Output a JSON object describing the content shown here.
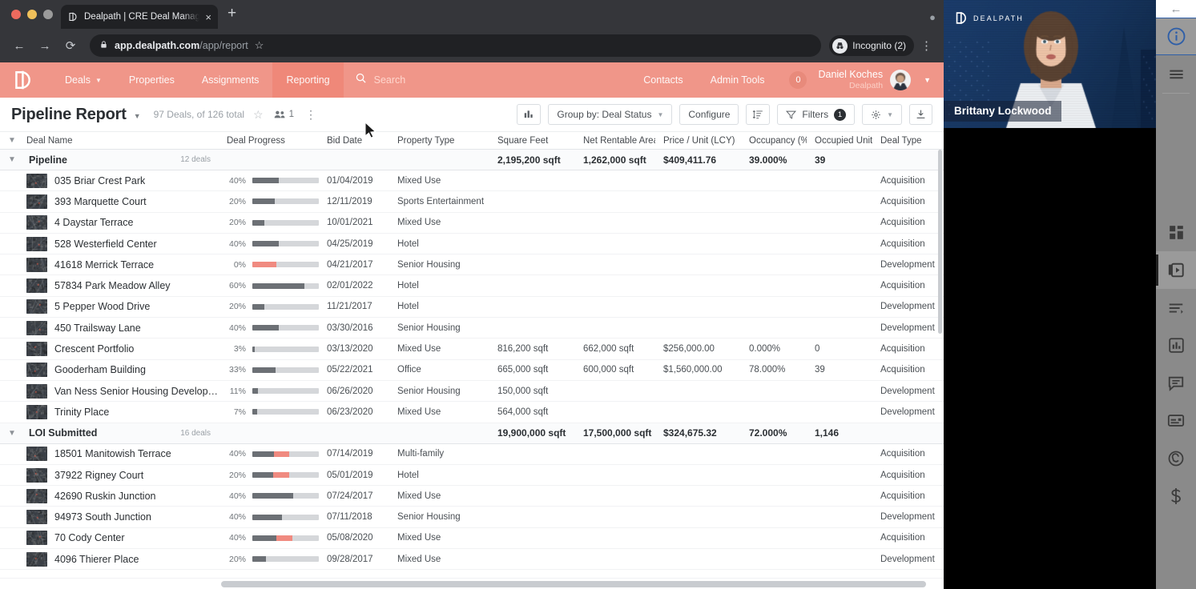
{
  "browser": {
    "tab": {
      "title": "Dealpath | CRE Deal Managem",
      "favicon": "dealpath-icon",
      "close": "×"
    },
    "new_tab": "+",
    "back": "←",
    "forward": "→",
    "reload": "⟳",
    "url_domain": "app.dealpath.com",
    "url_path": "/app/report",
    "lock": "🔒",
    "star": "☆",
    "profile_label": "Incognito (2)",
    "menu": "⋮"
  },
  "appnav": {
    "logo": "dealpath-logo",
    "items": [
      {
        "label": "Deals",
        "has_caret": true,
        "active": false
      },
      {
        "label": "Properties",
        "has_caret": false,
        "active": false
      },
      {
        "label": "Assignments",
        "has_caret": false,
        "active": false
      },
      {
        "label": "Reporting",
        "has_caret": false,
        "active": true
      }
    ],
    "search_placeholder": "Search",
    "right_items": [
      {
        "label": "Contacts"
      },
      {
        "label": "Admin Tools"
      }
    ],
    "notification_count": "0",
    "user_name": "Daniel Koches",
    "user_org": "Dealpath"
  },
  "report": {
    "title": "Pipeline Report",
    "count_text": "97 Deals, of 126 total",
    "share_count": "1",
    "toolbar": {
      "chart_button": "bar-chart-icon",
      "group_by": "Group by: Deal Status",
      "configure": "Configure",
      "sort_button": "sort-icon",
      "filters": "Filters",
      "filters_count": "1",
      "settings": "gear-icon",
      "download": "download-icon"
    }
  },
  "table": {
    "columns": [
      "Deal Name",
      "Deal Progress",
      "Bid Date",
      "Property Type",
      "Square Feet",
      "Net Rentable Area",
      "Price / Unit (LCY)",
      "Occupancy (%)",
      "Occupied Units",
      "Deal Type"
    ],
    "groups": [
      {
        "name": "Pipeline",
        "count": "12 deals",
        "summary": {
          "square_feet": "2,195,200 sqft",
          "net_rentable_area": "1,262,000 sqft",
          "price_per_unit": "$409,411.76",
          "occupancy": "39.000%",
          "occupied_units": "39"
        },
        "rows": [
          {
            "name": "035 Briar Crest Park",
            "pct": "40%",
            "fill": 40,
            "late": 0,
            "bid_date": "01/04/2019",
            "property_type": "Mixed Use",
            "square_feet": "",
            "nra": "",
            "price": "",
            "occupancy": "",
            "units": "",
            "deal_type": "Acquisition"
          },
          {
            "name": "393 Marquette Court",
            "pct": "20%",
            "fill": 34,
            "late": 0,
            "bid_date": "12/11/2019",
            "property_type": "Sports Entertainment",
            "square_feet": "",
            "nra": "",
            "price": "",
            "occupancy": "",
            "units": "",
            "deal_type": "Acquisition"
          },
          {
            "name": "4 Daystar Terrace",
            "pct": "20%",
            "fill": 18,
            "late": 0,
            "bid_date": "10/01/2021",
            "property_type": "Mixed Use",
            "square_feet": "",
            "nra": "",
            "price": "",
            "occupancy": "",
            "units": "",
            "deal_type": "Acquisition"
          },
          {
            "name": "528 Westerfield Center",
            "pct": "40%",
            "fill": 40,
            "late": 0,
            "bid_date": "04/25/2019",
            "property_type": "Hotel",
            "square_feet": "",
            "nra": "",
            "price": "",
            "occupancy": "",
            "units": "",
            "deal_type": "Acquisition"
          },
          {
            "name": "41618 Merrick Terrace",
            "pct": "0%",
            "fill": 36,
            "late": 36,
            "bid_date": "04/21/2017",
            "property_type": "Senior Housing",
            "square_feet": "",
            "nra": "",
            "price": "",
            "occupancy": "",
            "units": "",
            "deal_type": "Development"
          },
          {
            "name": "57834 Park Meadow Alley",
            "pct": "60%",
            "fill": 78,
            "late": 0,
            "bid_date": "02/01/2022",
            "property_type": "Hotel",
            "square_feet": "",
            "nra": "",
            "price": "",
            "occupancy": "",
            "units": "",
            "deal_type": "Acquisition"
          },
          {
            "name": "5 Pepper Wood Drive",
            "pct": "20%",
            "fill": 18,
            "late": 0,
            "bid_date": "11/21/2017",
            "property_type": "Hotel",
            "square_feet": "",
            "nra": "",
            "price": "",
            "occupancy": "",
            "units": "",
            "deal_type": "Development"
          },
          {
            "name": "450 Trailsway Lane",
            "pct": "40%",
            "fill": 40,
            "late": 0,
            "bid_date": "03/30/2016",
            "property_type": "Senior Housing",
            "square_feet": "",
            "nra": "",
            "price": "",
            "occupancy": "",
            "units": "",
            "deal_type": "Development"
          },
          {
            "name": "Crescent Portfolio",
            "pct": "3%",
            "fill": 4,
            "late": 0,
            "bid_date": "03/13/2020",
            "property_type": "Mixed Use",
            "square_feet": "816,200 sqft",
            "nra": "662,000 sqft",
            "price": "$256,000.00",
            "occupancy": "0.000%",
            "units": "0",
            "deal_type": "Acquisition"
          },
          {
            "name": "Gooderham Building",
            "pct": "33%",
            "fill": 35,
            "late": 0,
            "bid_date": "05/22/2021",
            "property_type": "Office",
            "square_feet": "665,000 sqft",
            "nra": "600,000 sqft",
            "price": "$1,560,000.00",
            "occupancy": "78.000%",
            "units": "39",
            "deal_type": "Acquisition"
          },
          {
            "name": "Van Ness Senior Housing Development",
            "pct": "11%",
            "fill": 9,
            "late": 0,
            "bid_date": "06/26/2020",
            "property_type": "Senior Housing",
            "square_feet": "150,000 sqft",
            "nra": "",
            "price": "",
            "occupancy": "",
            "units": "",
            "deal_type": "Development"
          },
          {
            "name": "Trinity Place",
            "pct": "7%",
            "fill": 7,
            "late": 0,
            "bid_date": "06/23/2020",
            "property_type": "Mixed Use",
            "square_feet": "564,000 sqft",
            "nra": "",
            "price": "",
            "occupancy": "",
            "units": "",
            "deal_type": "Development"
          }
        ]
      },
      {
        "name": "LOI Submitted",
        "count": "16 deals",
        "summary": {
          "square_feet": "19,900,000 sqft",
          "net_rentable_area": "17,500,000 sqft",
          "price_per_unit": "$324,675.32",
          "occupancy": "72.000%",
          "occupied_units": "1,146"
        },
        "rows": [
          {
            "name": "18501 Manitowish Terrace",
            "pct": "40%",
            "fill": 55,
            "late": 22,
            "bid_date": "07/14/2019",
            "property_type": "Multi-family",
            "square_feet": "",
            "nra": "",
            "price": "",
            "occupancy": "",
            "units": "",
            "deal_type": "Acquisition"
          },
          {
            "name": "37922 Rigney Court",
            "pct": "20%",
            "fill": 55,
            "late": 24,
            "bid_date": "05/01/2019",
            "property_type": "Hotel",
            "square_feet": "",
            "nra": "",
            "price": "",
            "occupancy": "",
            "units": "",
            "deal_type": "Acquisition"
          },
          {
            "name": "42690 Ruskin Junction",
            "pct": "40%",
            "fill": 62,
            "late": 0,
            "bid_date": "07/24/2017",
            "property_type": "Mixed Use",
            "square_feet": "",
            "nra": "",
            "price": "",
            "occupancy": "",
            "units": "",
            "deal_type": "Acquisition"
          },
          {
            "name": "94973 South Junction",
            "pct": "40%",
            "fill": 44,
            "late": 0,
            "bid_date": "07/11/2018",
            "property_type": "Senior Housing",
            "square_feet": "",
            "nra": "",
            "price": "",
            "occupancy": "",
            "units": "",
            "deal_type": "Development"
          },
          {
            "name": "70 Cody Center",
            "pct": "40%",
            "fill": 60,
            "late": 24,
            "bid_date": "05/08/2020",
            "property_type": "Mixed Use",
            "square_feet": "",
            "nra": "",
            "price": "",
            "occupancy": "",
            "units": "",
            "deal_type": "Acquisition"
          },
          {
            "name": "4096 Thierer Place",
            "pct": "20%",
            "fill": 20,
            "late": 0,
            "bid_date": "09/28/2017",
            "property_type": "Mixed Use",
            "square_feet": "",
            "nra": "",
            "price": "",
            "occupancy": "",
            "units": "",
            "deal_type": "Development"
          }
        ]
      }
    ]
  },
  "video": {
    "logo_text": "DEALPATH",
    "speaker_name": "Brittany Lockwood"
  },
  "rail": {
    "back": "←",
    "items": [
      {
        "icon": "info-icon",
        "name": "info",
        "selected": false,
        "highlight": true
      },
      {
        "icon": "hamburger-icon",
        "name": "menu",
        "selected": false,
        "highlight": false
      },
      {
        "icon": "grid-icon",
        "name": "layout",
        "selected": false,
        "highlight": false
      },
      {
        "icon": "video-play-icon",
        "name": "video",
        "selected": true,
        "highlight": false
      },
      {
        "icon": "list-icon",
        "name": "list",
        "selected": false,
        "highlight": false
      },
      {
        "icon": "bar-chart-icon",
        "name": "chart",
        "selected": false,
        "highlight": false
      },
      {
        "icon": "chat-icon",
        "name": "chat",
        "selected": false,
        "highlight": false
      },
      {
        "icon": "card-icon",
        "name": "card",
        "selected": false,
        "highlight": false
      },
      {
        "icon": "copyright-icon",
        "name": "copyright",
        "selected": false,
        "highlight": false
      },
      {
        "icon": "dollar-icon",
        "name": "dollar",
        "selected": false,
        "highlight": false
      }
    ]
  },
  "colors": {
    "nav_accent": "#f09689",
    "nav_active": "#ef8878",
    "progress_fill": "#6c7075",
    "progress_late": "#f08a80",
    "video_bg": "#14335e"
  }
}
